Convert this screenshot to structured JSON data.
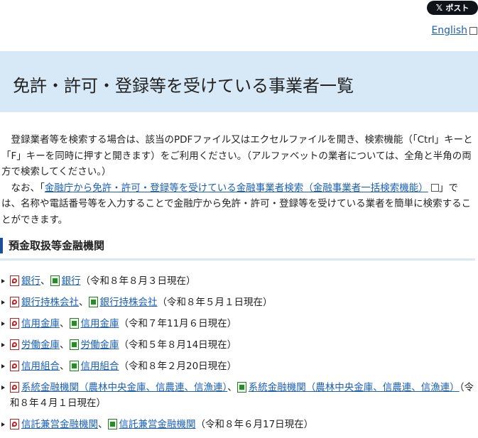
{
  "header": {
    "post_button": "ポスト",
    "post_icon": "x-logo-icon",
    "language_link": "English"
  },
  "title": "免許・許可・登録等を受けている事業者一覧",
  "intro": {
    "p1": "登録業者等を検索する場合は、該当のPDFファイル又はエクセルファイルを開き、検索機能（「Ctrl」キーと「F」キーを同時に押すと開きます）をご利用ください。（アルファベットの業者については、全角と半角の両方で検索してください。）",
    "p2_prefix": "なお、「",
    "p2_link": "金融庁から免許・許可・登録等を受けている金融事業者検索（金融事業者一括検索機能）",
    "p2_suffix": "」では、名称や電話番号等を入力することで金融庁から免許・許可・登録等を受けている業者を簡単に検索することができます。"
  },
  "section": {
    "heading": "預金取扱等金融機関"
  },
  "items": [
    {
      "pdf": "銀行",
      "xls": "銀行",
      "date": "（令和８年８月３日現在）"
    },
    {
      "pdf": "銀行持株会社",
      "xls": "銀行持株会社",
      "date": "（令和８年５月１日現在）"
    },
    {
      "pdf": "信用金庫",
      "xls": "信用金庫",
      "date": "（令和７年11月６日現在）"
    },
    {
      "pdf": "労働金庫",
      "xls": "労働金庫",
      "date": "（令和５年８月14日現在）"
    },
    {
      "pdf": "信用組合",
      "xls": "信用組合",
      "date": "（令和８年２月20日現在）"
    },
    {
      "pdf": "系統金融機関（農林中央金庫、信農連、信漁連）",
      "xls": "系統金融機関（農林中央金庫、信農連、信漁連）",
      "date": "（令和８年４月１日現在）"
    },
    {
      "pdf": "信託兼営金融機関",
      "xls": "信託兼営金融機関",
      "date": "（令和８年６月17日現在）"
    }
  ],
  "separator": "、",
  "colors": {
    "link": "#1a5fb4",
    "title_band": "#d7e8f6",
    "section_bar": "#1b4d9a"
  }
}
